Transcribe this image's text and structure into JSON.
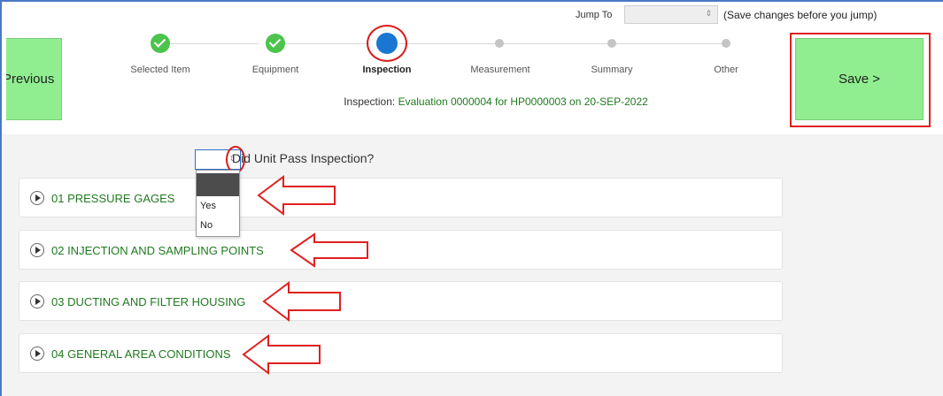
{
  "toolbar": {
    "previous_label": "Previous",
    "save_label": "Save >",
    "jump_label": "Jump To",
    "jump_value": "",
    "jump_note": "(Save changes before you jump)"
  },
  "steps": [
    {
      "label": "Selected Item",
      "state": "done"
    },
    {
      "label": "Equipment",
      "state": "done"
    },
    {
      "label": "Inspection",
      "state": "current"
    },
    {
      "label": "Measurement",
      "state": "todo"
    },
    {
      "label": "Summary",
      "state": "todo"
    },
    {
      "label": "Other",
      "state": "todo"
    }
  ],
  "inspection": {
    "prefix": "Inspection: ",
    "value": "Evaluation 0000004 for HP0000003 on 20-SEP-2022"
  },
  "pass_question": {
    "label": "Did Unit Pass Inspection?",
    "selected": "",
    "options": [
      "",
      "Yes",
      "No"
    ]
  },
  "sections": [
    {
      "title": "01 PRESSURE GAGES"
    },
    {
      "title": "02 INJECTION AND SAMPLING POINTS"
    },
    {
      "title": "03 DUCTING AND FILTER HOUSING"
    },
    {
      "title": "04 GENERAL AREA CONDITIONS"
    }
  ],
  "colors": {
    "accent_green": "#90ee90",
    "done_step": "#4cc44c",
    "current_step": "#1976d2",
    "link_green": "#1f7a1f",
    "annotation_red": "#e02020"
  }
}
